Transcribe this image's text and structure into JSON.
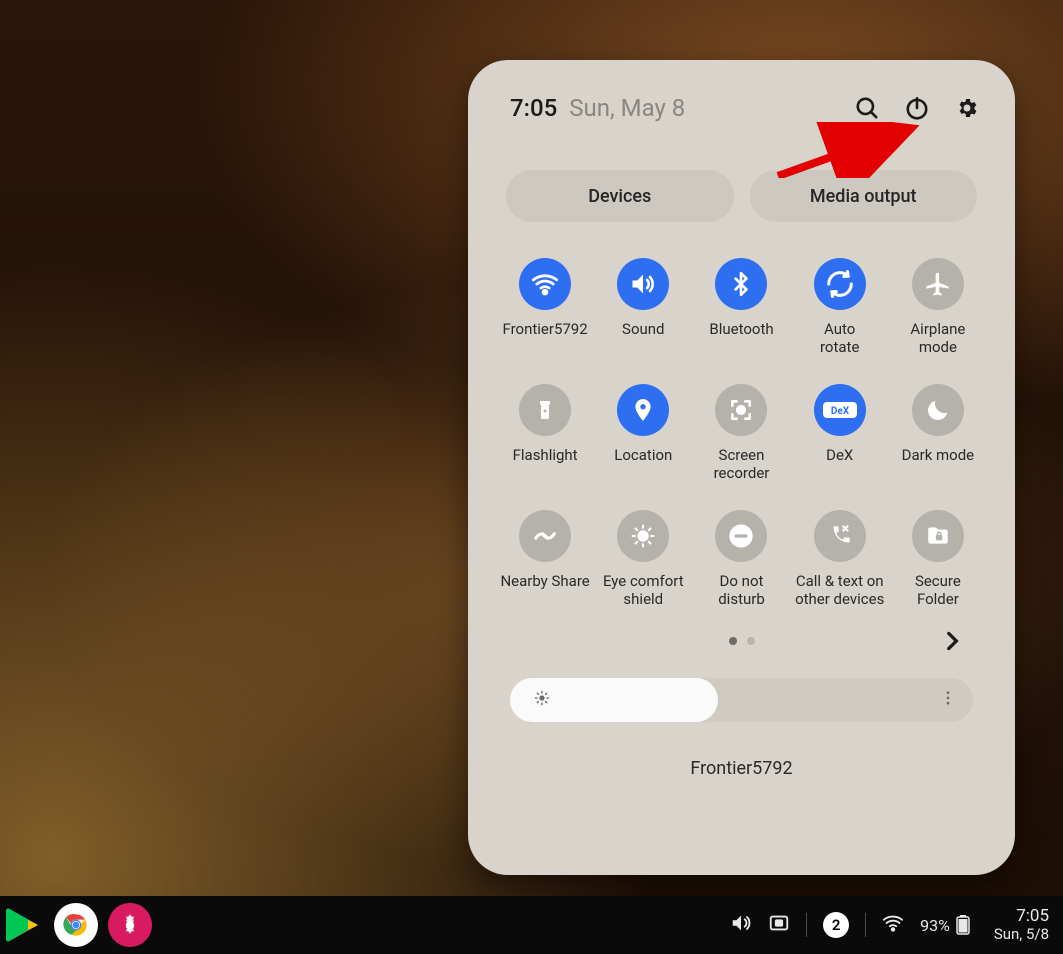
{
  "header": {
    "time": "7:05",
    "date": "Sun, May 8"
  },
  "pills": {
    "devices": "Devices",
    "media": "Media output"
  },
  "tiles": [
    {
      "id": "wifi",
      "label": "Frontier5792",
      "state": "on",
      "icon": "wifi"
    },
    {
      "id": "sound",
      "label": "Sound",
      "state": "on",
      "icon": "volume"
    },
    {
      "id": "bluetooth",
      "label": "Bluetooth",
      "state": "on",
      "icon": "bluetooth"
    },
    {
      "id": "autorotate",
      "label": "Auto\nrotate",
      "state": "on",
      "icon": "rotate"
    },
    {
      "id": "airplane",
      "label": "Airplane\nmode",
      "state": "off",
      "icon": "airplane"
    },
    {
      "id": "flashlight",
      "label": "Flashlight",
      "state": "off",
      "icon": "flashlight"
    },
    {
      "id": "location",
      "label": "Location",
      "state": "on",
      "icon": "location"
    },
    {
      "id": "screenrec",
      "label": "Screen\nrecorder",
      "state": "off",
      "icon": "screenrec"
    },
    {
      "id": "dex",
      "label": "DeX",
      "state": "on",
      "icon": "dex"
    },
    {
      "id": "darkmode",
      "label": "Dark mode",
      "state": "off",
      "icon": "moon"
    },
    {
      "id": "nearby",
      "label": "Nearby Share",
      "state": "off",
      "icon": "nearby"
    },
    {
      "id": "eyecomfort",
      "label": "Eye comfort\nshield",
      "state": "off",
      "icon": "eyecare"
    },
    {
      "id": "dnd",
      "label": "Do not\ndisturb",
      "state": "off",
      "icon": "dnd"
    },
    {
      "id": "callswitch",
      "label": "Call & text on\nother devices",
      "state": "off",
      "icon": "callswitch"
    },
    {
      "id": "secfolder",
      "label": "Secure\nFolder",
      "state": "off",
      "icon": "folderlock"
    }
  ],
  "pagination": {
    "pages": 2,
    "active": 0
  },
  "brightness": {
    "fill_percent": 45
  },
  "network_footer": "Frontier5792",
  "taskbar": {
    "notification_count": "2",
    "battery_percent": "93%",
    "time": "7:05",
    "date": "Sun, 5/8"
  },
  "colors": {
    "panel_bg": "#d8d3cb",
    "accent": "#2e6ff2",
    "inactive": "#b5b1ab"
  }
}
